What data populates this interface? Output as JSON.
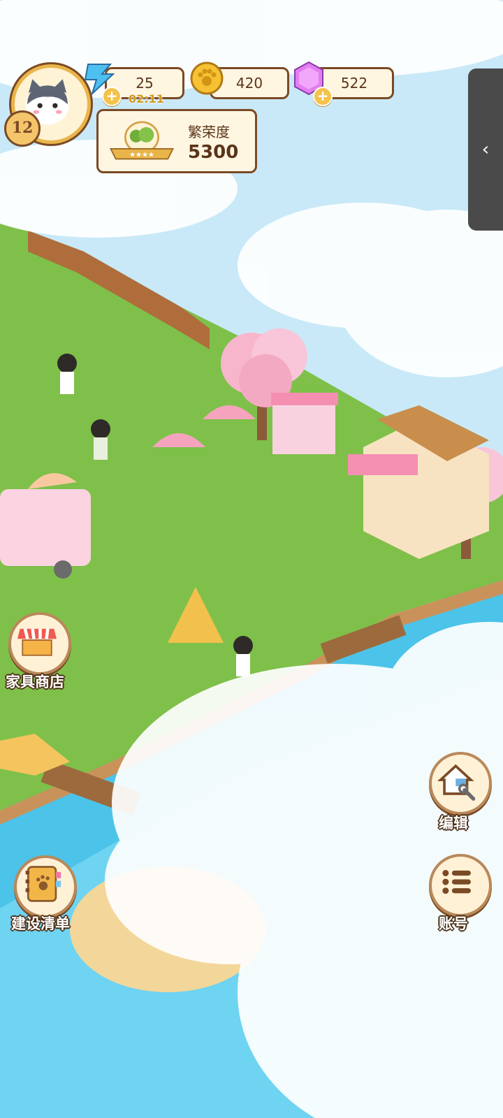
{
  "hud": {
    "level": "12",
    "energy": {
      "value": "25",
      "timer": "02:11"
    },
    "coins": {
      "value": "420"
    },
    "gems": {
      "value": "522"
    },
    "prosperity": {
      "label": "繁荣度",
      "value": "5300"
    }
  },
  "buttons": {
    "furniture_shop": "家具商店",
    "edit": "编辑",
    "build_list": "建设清单",
    "account": "账号"
  },
  "side_tab_icon": "chevron-left-icon",
  "colors": {
    "grass": "#7fc04a",
    "water": "#4cc3e8",
    "frame_brown": "#7a4a25",
    "panel_cream": "#fff6e2",
    "sakura_pink": "#f7b6cc"
  }
}
